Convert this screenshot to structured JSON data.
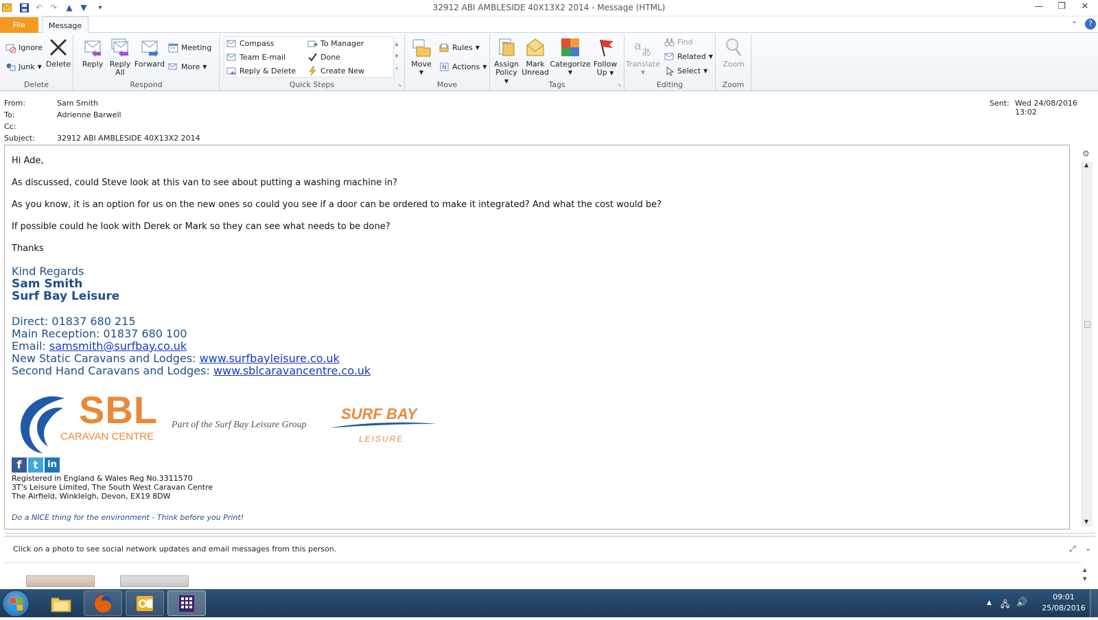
{
  "window": {
    "title": "32912 ABI AMBLESIDE 40X13X2  2014  -  Message (HTML)",
    "controls": {
      "minimize": "—",
      "restore": "❐",
      "close": "✕"
    }
  },
  "tabs": {
    "file": "File",
    "message": "Message"
  },
  "ribbon": {
    "delete": {
      "label": "Delete",
      "ignore": "Ignore",
      "junk": "Junk",
      "delete": "Delete"
    },
    "respond": {
      "label": "Respond",
      "reply": "Reply",
      "reply_all_1": "Reply",
      "reply_all_2": "All",
      "forward": "Forward",
      "meeting": "Meeting",
      "more": "More"
    },
    "quick_steps": {
      "label": "Quick Steps",
      "items": [
        "Compass",
        "To Manager",
        "Team E-mail",
        "Done",
        "Reply & Delete",
        "Create New"
      ]
    },
    "move": {
      "label": "Move",
      "move": "Move",
      "rules": "Rules",
      "actions": "Actions"
    },
    "tags": {
      "label": "Tags",
      "assign_1": "Assign",
      "assign_2": "Policy",
      "mark_1": "Mark",
      "mark_2": "Unread",
      "categorize": "Categorize",
      "follow_1": "Follow",
      "follow_2": "Up"
    },
    "editing": {
      "label": "Editing",
      "translate": "Translate",
      "find": "Find",
      "related": "Related",
      "select": "Select"
    },
    "zoom": {
      "label": "Zoom",
      "zoom": "Zoom"
    }
  },
  "header": {
    "from_label": "From:",
    "from": "Sam Smith",
    "to_label": "To:",
    "to": "Adrienne Barwell",
    "cc_label": "Cc:",
    "subject_label": "Subject:",
    "subject": "32912 ABI AMBLESIDE 40X13X2  2014",
    "sent_label": "Sent:",
    "sent": "Wed 24/08/2016 13:02"
  },
  "body": {
    "greeting": "Hi Ade,",
    "p1": "As discussed, could Steve look at this van to see about putting a washing machine in?",
    "p2": "As you know, it is an option for us on the new ones so could you see if a door can be ordered to make it integrated? And what the cost would be?",
    "p3": "If possible could he look with Derek or Mark so they can see what needs to be done?",
    "thanks": "Thanks",
    "sig_regards": "Kind Regards",
    "sig_name": "Sam Smith",
    "sig_company": "Surf Bay Leisure",
    "direct_label": "Direct:  01837 680 215",
    "main_label": "Main Reception:  01837 680 100",
    "email_label": "Email: ",
    "email": "samsmith@surfbay.co.uk",
    "new_label": "New Static Caravans and Lodges: ",
    "new_url": "www.surfbayleisure.co.uk",
    "second_label": "Second Hand Caravans and Lodges: ",
    "second_url": "www.sblcaravancentre.co.uk",
    "logo_sbl": "SBL",
    "logo_caravan": "CARAVAN CENTRE",
    "logo_part_of": "Part of the Surf Bay Leisure Group",
    "logo_surf_bay": "SURF BAY",
    "logo_leisure": "LEISURE",
    "reg1": "Registered in England & Wales Reg No.3311570",
    "reg2": "3T's Leisure Limited, The South West Caravan Centre",
    "reg3": "The Airfield, Winkleigh, Devon, EX19 8DW",
    "env": "Do a NICE thing for the environment - Think before you Print!"
  },
  "people_pane": {
    "text": "Click on a photo to see social network updates and email messages from this person."
  },
  "taskbar": {
    "time": "09:01",
    "date": "25/08/2016"
  },
  "colors": {
    "file_tab": "#f39b1e",
    "signature": "#1f4e8c",
    "link": "#1438c8",
    "logo_orange": "#e8893a",
    "logo_blue": "#1f5aa8"
  }
}
